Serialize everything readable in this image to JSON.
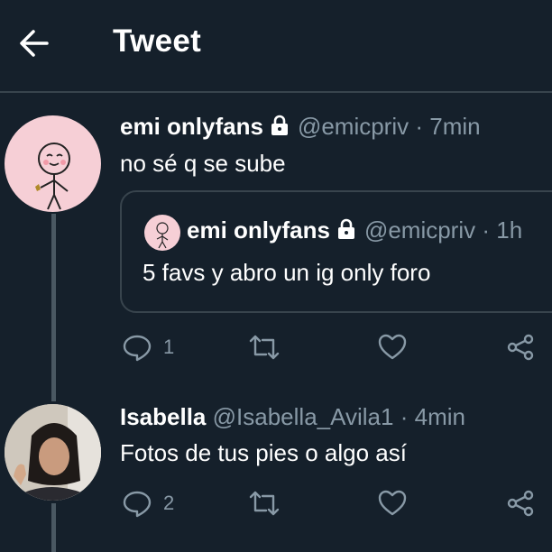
{
  "header": {
    "title": "Tweet"
  },
  "tweet": {
    "name": "emi onlyfans",
    "handle": "@emicpriv",
    "separator": "·",
    "time": "7min",
    "text": "no sé q se sube",
    "reply_count": "1"
  },
  "quoted": {
    "name": "emi onlyfans",
    "handle": "@emicpriv",
    "separator": "·",
    "time": "1h",
    "text": "5 favs y abro un ig only foro"
  },
  "reply": {
    "name": "Isabella",
    "handle": "@Isabella_Avila1",
    "separator": "·",
    "time": "4min",
    "text": "Fotos de tus pies o algo así",
    "reply_count": "2"
  },
  "colors": {
    "background": "#15202b",
    "muted": "#8899a6",
    "border": "#38444d"
  },
  "icons": [
    "back-arrow-icon",
    "lock-icon",
    "reply-icon",
    "retweet-icon",
    "like-icon",
    "share-icon"
  ]
}
